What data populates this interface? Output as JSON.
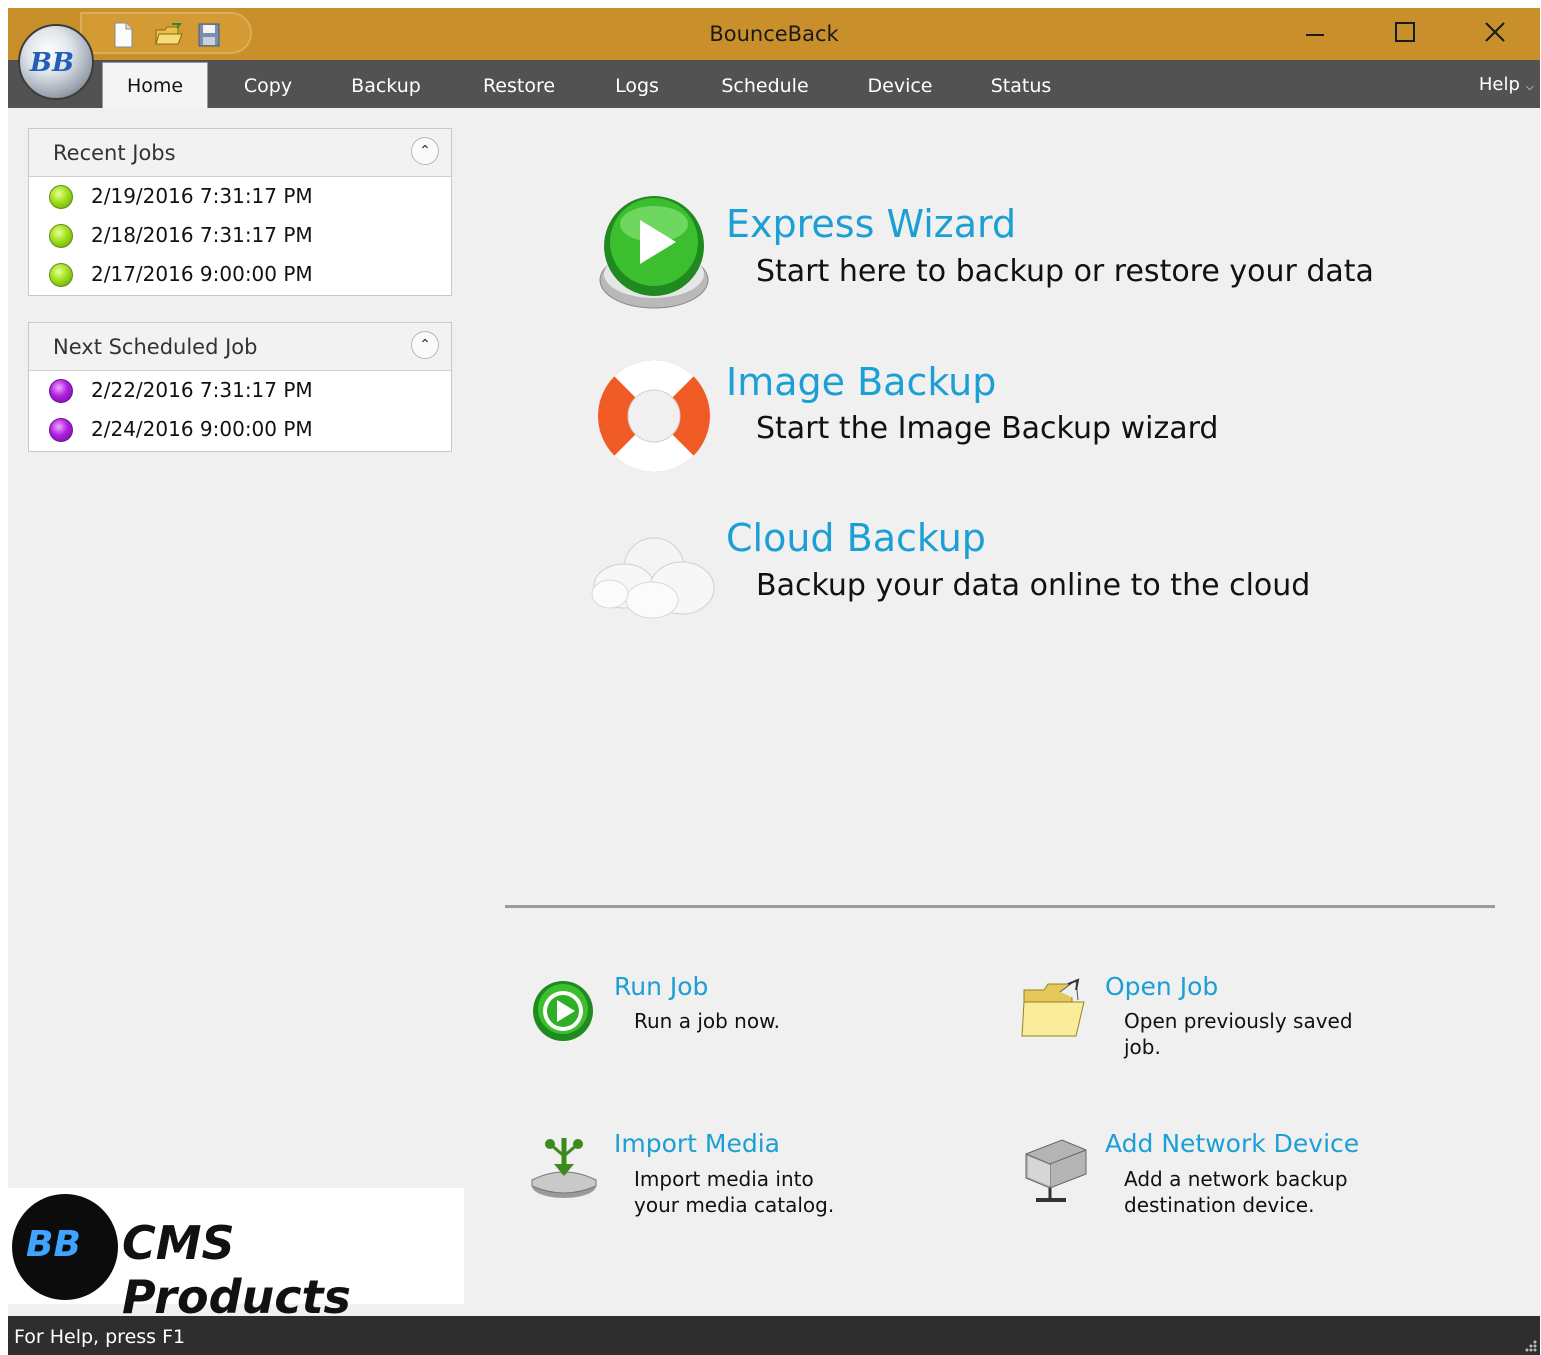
{
  "window": {
    "title": "BounceBack"
  },
  "app_orb": {
    "label": "BB"
  },
  "quick_access": {
    "icons": [
      "new-file-icon",
      "open-folder-icon",
      "save-icon"
    ]
  },
  "tabs": [
    {
      "label": "Home",
      "active": true
    },
    {
      "label": "Copy"
    },
    {
      "label": "Backup"
    },
    {
      "label": "Restore"
    },
    {
      "label": "Logs"
    },
    {
      "label": "Schedule"
    },
    {
      "label": "Device"
    },
    {
      "label": "Status"
    }
  ],
  "help": {
    "label": "Help"
  },
  "recent_jobs": {
    "title": "Recent Jobs",
    "items": [
      {
        "date": "2/19/2016 7:31:17 PM",
        "status": "green"
      },
      {
        "date": "2/18/2016 7:31:17 PM",
        "status": "green"
      },
      {
        "date": "2/17/2016 9:00:00 PM",
        "status": "green"
      }
    ]
  },
  "next_scheduled": {
    "title": "Next Scheduled Job",
    "items": [
      {
        "date": "2/22/2016 7:31:17 PM",
        "status": "purple"
      },
      {
        "date": "2/24/2016 9:00:00 PM",
        "status": "purple"
      }
    ]
  },
  "main_actions": [
    {
      "title": "Express Wizard",
      "description": "Start here to backup or restore your data",
      "icon": "play-button-icon"
    },
    {
      "title": "Image Backup",
      "description": "Start the Image Backup wizard",
      "icon": "lifebuoy-icon"
    },
    {
      "title": "Cloud Backup",
      "description": "Backup your data online to the cloud",
      "icon": "cloud-icon"
    }
  ],
  "quick_actions": [
    {
      "title": "Run Job",
      "description": "Run a job now.",
      "icon": "run-job-icon"
    },
    {
      "title": "Open Job",
      "description": "Open previously saved job.",
      "icon": "open-folder-icon"
    },
    {
      "title": "Import Media",
      "description": "Import media into your media catalog.",
      "icon": "import-media-icon"
    },
    {
      "title": "Add Network Device",
      "description": "Add a network backup destination device.",
      "icon": "network-drive-icon"
    }
  ],
  "logo": {
    "mark": "BB",
    "text": "CMS Products"
  },
  "status_bar": {
    "text": "For Help, press F1"
  },
  "colors": {
    "title_bar": "#c98f2a",
    "tab_bar": "#525252",
    "link": "#1b9fd5",
    "status_bar": "#2e2e2e"
  }
}
